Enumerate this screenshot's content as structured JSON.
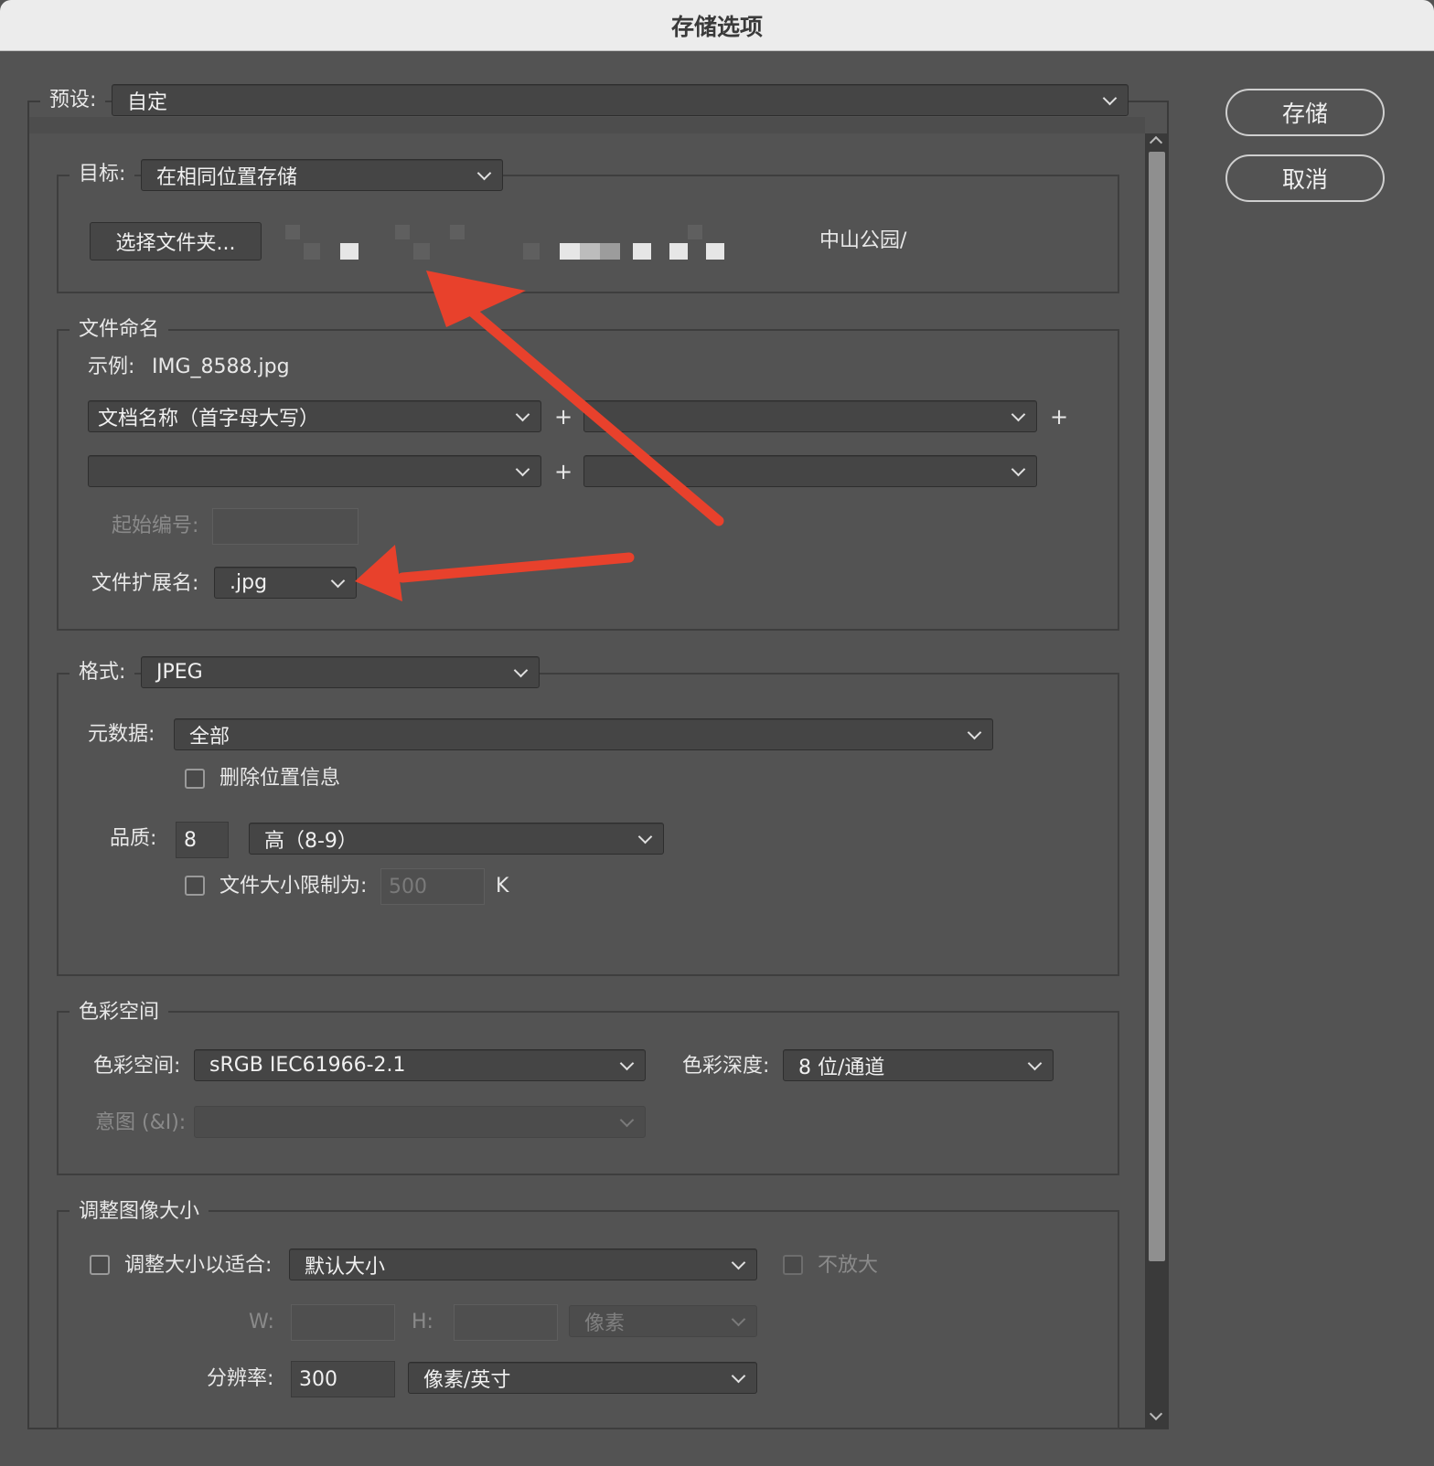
{
  "window": {
    "title": "存储选项"
  },
  "buttons": {
    "save": "存储",
    "cancel": "取消"
  },
  "preset": {
    "label": "预设:",
    "value": "自定"
  },
  "target": {
    "label": "目标:",
    "value": "在相同位置存储",
    "choose_folder": "选择文件夹...",
    "path_tail": "中山公园/"
  },
  "file_naming": {
    "legend": "文件命名",
    "example_label": "示例:",
    "example_value": "IMG_8588.jpg",
    "field1": "文档名称（首字母大写）",
    "field2": "",
    "field3": "",
    "field4": "",
    "plus": "+",
    "start_number_label": "起始编号:",
    "start_number_value": "",
    "extension_label": "文件扩展名:",
    "extension_value": ".jpg"
  },
  "format": {
    "label": "格式:",
    "value": "JPEG",
    "metadata_label": "元数据:",
    "metadata_value": "全部",
    "remove_location_label": "删除位置信息",
    "quality_label": "品质:",
    "quality_value": "8",
    "quality_level": "高（8-9）",
    "size_limit_label": "文件大小限制为:",
    "size_limit_value": "500",
    "size_limit_unit": "K"
  },
  "color_space": {
    "legend": "色彩空间",
    "space_label": "色彩空间:",
    "space_value": "sRGB IEC61966-2.1",
    "depth_label": "色彩深度:",
    "depth_value": "8 位/通道",
    "intent_label": "意图 (&I):",
    "intent_value": ""
  },
  "resize": {
    "legend": "调整图像大小",
    "fit_label": "调整大小以适合:",
    "fit_value": "默认大小",
    "no_enlarge_label": "不放大",
    "w_label": "W:",
    "h_label": "H:",
    "w_value": "",
    "h_value": "",
    "unit_value": "像素",
    "resolution_label": "分辨率:",
    "resolution_value": "300",
    "resolution_unit": "像素/英寸"
  },
  "colors": {
    "annotation_arrow": "#e8412c",
    "background": "#535353"
  },
  "icons": [
    "chevron-down-icon",
    "scroll-up-arrow-icon",
    "scroll-down-arrow-icon",
    "annotation-arrow"
  ]
}
